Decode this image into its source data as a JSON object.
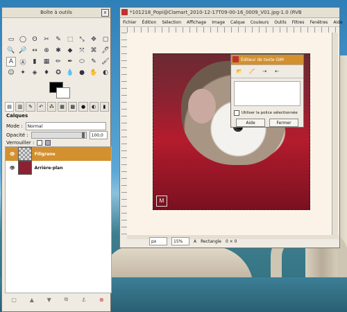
{
  "toolbox": {
    "title": "Boîte à outils",
    "close": "x",
    "tools": [
      "▭",
      "◯",
      "ʘ",
      "✂",
      "✎",
      "⬚",
      "⤡",
      "✥",
      "▢",
      "🔍",
      "🔎",
      "↔",
      "⊕",
      "✱",
      "◆",
      "⤧",
      "⌘",
      "🖊",
      "A",
      "Ⓐ",
      "▮",
      "▦",
      "✏",
      "✒",
      "⬭",
      "✎",
      "🖌",
      "☺",
      "✦",
      "◈",
      "♦",
      "✪",
      "💧",
      "●",
      "✋",
      "◐"
    ],
    "layers_panel": {
      "label": "Calques",
      "mode_label": "Mode :",
      "mode_value": "Normal",
      "opacity_label": "Opacité :",
      "opacity_value": "100,0",
      "lock_label": "Verrouiller :",
      "layers": [
        {
          "name": "Filigrane",
          "selected": true
        },
        {
          "name": "Arrière-plan",
          "selected": false
        }
      ]
    }
  },
  "image_window": {
    "title": "*101218_Popi@Clamart_2010-12-17T09-00-16_0009_V01.jpg-1.0 (RVB",
    "menu": [
      "Fichier",
      "Édition",
      "Sélection",
      "Affichage",
      "Image",
      "Calque",
      "Couleurs",
      "Outils",
      "Filtres",
      "Fenêtres",
      "Aide"
    ],
    "status": {
      "unit": "px",
      "zoom": "15%",
      "tool_info": "Rectangle",
      "size_readout": "0 × 0"
    },
    "watermark": "Ꮇ"
  },
  "text_editor": {
    "title": "Éditeur de texte GIM",
    "option_label": "Utiliser la police sélectionnée",
    "help_button": "Aide",
    "close_button": "Fermer"
  }
}
